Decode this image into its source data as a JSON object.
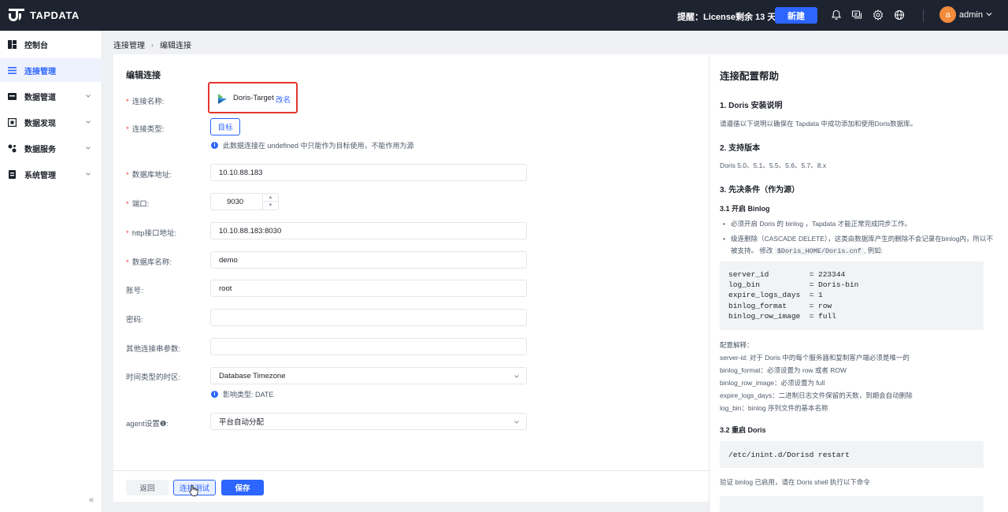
{
  "app": {
    "logo_text": "TAPDATA",
    "notice": "提醒：License剩余 13 天到期",
    "new_button": "新建",
    "avatar_initial": "a",
    "username": "admin"
  },
  "sidebar": {
    "items": [
      {
        "label": "控制台",
        "icon": "dashboard-icon",
        "active": false,
        "has_caret": false
      },
      {
        "label": "连接管理",
        "icon": "list-icon",
        "active": true,
        "has_caret": false
      },
      {
        "label": "数据管道",
        "icon": "pipeline-icon",
        "active": false,
        "has_caret": true
      },
      {
        "label": "数据发现",
        "icon": "discover-icon",
        "active": false,
        "has_caret": true
      },
      {
        "label": "数据服务",
        "icon": "service-icon",
        "active": false,
        "has_caret": true
      },
      {
        "label": "系统管理",
        "icon": "system-icon",
        "active": false,
        "has_caret": true
      }
    ],
    "collapse": "«"
  },
  "breadcrumb": {
    "parent": "连接管理",
    "separator": "›",
    "current": "编辑连接"
  },
  "form": {
    "title": "编辑连接",
    "name_label": "连接名称:",
    "name_value": "Doris-Target",
    "rename": "改名",
    "type_label": "连接类型:",
    "type_value": "目标",
    "type_hint": "此数据连接在 undefined 中只能作为目标使用，不能作用为源",
    "host_label": "数据库地址:",
    "host_value": "10.10.88.183",
    "port_label": "端口:",
    "port_value": "9030",
    "http_label": "http接口地址:",
    "http_value": "10.10.88.183:8030",
    "db_label": "数据库名称:",
    "db_value": "demo",
    "user_label": "账号:",
    "user_value": "root",
    "password_label": "密码:",
    "password_value": "",
    "extra_label": "其他连接串参数:",
    "extra_value": "",
    "tz_label": "时间类型的时区:",
    "tz_value": "Database Timezone",
    "tz_hint": "影响类型: DATE",
    "agent_label": "agent设置❶:",
    "agent_value": "平台自动分配",
    "back_button": "返回",
    "test_button": "连接测试",
    "save_button": "保存"
  },
  "help": {
    "title": "连接配置帮助",
    "s1_title": "1. Doris 安装说明",
    "s1_text": "请遵循以下说明以确保在 Tapdata 中成功添加和使用Doris数据库。",
    "s2_title": "2. 支持版本",
    "s2_text": "Doris 5.0、5.1、5.5、5.6、5.7、8.x",
    "s3_title": "3. 先决条件（作为源）",
    "s31_title": "3.1 开启 Binlog",
    "bullet1": "必须开启 Doris 的 binlog ，Tapdata 才能正常完成同步工作。",
    "bullet2_line1": "级连删除（CASCADE DELETE），这类由数据库产生的删除不会记录在binlog内，所以不",
    "bullet2_line2_pre": "被支持。 修改",
    "bullet2_code": "$Doris_HOME/Doris.cnf",
    "bullet2_post": ", 例如:",
    "code1": "server_id         = 223344\nlog_bin           = Doris-bin\nexpire_logs_days  = 1\nbinlog_format     = row\nbinlog_row_image  = full",
    "explain_title": "配置解释：",
    "explain_1": "server-id: 对于 Doris 中的每个服务器和复制客户端必须是唯一的",
    "explain_2": "binlog_format：必须设置为 row 或者 ROW",
    "explain_3": "binlog_row_image：必须设置为 full",
    "explain_4": "expire_logs_days：二进制日志文件保留的天数，到期会自动删除",
    "explain_5": "log_bin：binlog 序列文件的基本名称",
    "s32_title": "3.2 重启 Doris",
    "code2": "/etc/inint.d/Dorisd restart",
    "verify_text": "验证 binlog 已启用，请在 Doris shell 执行以下命令"
  },
  "colors": {
    "topbar": "#1e2330",
    "primary": "#2c65ff",
    "highlight_border": "#e3372e"
  }
}
